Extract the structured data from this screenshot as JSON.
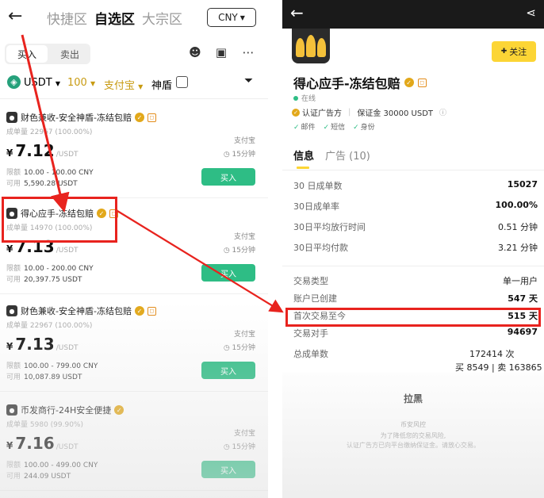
{
  "left": {
    "nav": {
      "back": "←",
      "tabs": [
        "快捷区",
        "自选区",
        "大宗区"
      ],
      "active_index": 1,
      "currency": "CNY"
    },
    "toggle": {
      "buy": "买入",
      "sell": "卖出"
    },
    "filters": {
      "coin": "USDT",
      "amount": "100",
      "payment": "支付宝",
      "shield": "神盾"
    },
    "cards": [
      {
        "merchant": "财色兼收-安全神盾-冻结包赔",
        "verified": true,
        "shield_badge": true,
        "stats_label": "成单量",
        "stats_value": "22967 (100.00%)",
        "payment": "支付宝",
        "price": "7.12",
        "unit": "USDT",
        "time": "15分钟",
        "limit_label": "限额",
        "limit": "10.00 - 100.00 CNY",
        "avail_label": "可用",
        "avail": "5,590.28 USDT",
        "button": "买入"
      },
      {
        "merchant": "得心应手-冻结包赔",
        "verified": true,
        "shield_badge": true,
        "stats_label": "成单量",
        "stats_value": "14970 (100.00%)",
        "payment": "支付宝",
        "price": "7.13",
        "unit": "USDT",
        "time": "15分钟",
        "limit_label": "限额",
        "limit": "10.00 - 200.00 CNY",
        "avail_label": "可用",
        "avail": "20,397.75 USDT",
        "button": "买入"
      },
      {
        "merchant": "财色兼收-安全神盾-冻结包赔",
        "verified": true,
        "shield_badge": true,
        "stats_label": "成单量",
        "stats_value": "22967 (100.00%)",
        "payment": "支付宝",
        "price": "7.13",
        "unit": "USDT",
        "time": "15分钟",
        "limit_label": "限额",
        "limit": "100.00 - 799.00 CNY",
        "avail_label": "可用",
        "avail": "10,087.89 USDT",
        "button": "买入"
      },
      {
        "merchant": "币发商行-24H安全便捷",
        "verified": true,
        "shield_badge": false,
        "stats_label": "成单量",
        "stats_value": "5980 (99.90%)",
        "payment": "支付宝",
        "price": "7.16",
        "unit": "USDT",
        "time": "15分钟",
        "limit_label": "限额",
        "limit": "100.00 - 499.00 CNY",
        "avail_label": "可用",
        "avail": "244.09 USDT",
        "button": "买入"
      }
    ],
    "currency_symbol": "¥"
  },
  "right": {
    "header": {
      "back": "←",
      "share": "<"
    },
    "follow": "关注",
    "name": "得心应手-冻结包赔",
    "online": "在线",
    "badges": {
      "advertiser": "认证广告方",
      "deposit": "保证金 30000 USDT"
    },
    "verify": [
      "邮件",
      "短信",
      "身份"
    ],
    "tabs": {
      "info": "信息",
      "ads": "广告 (10)"
    },
    "stats": [
      {
        "k": "30 日成单数",
        "v": "15027"
      },
      {
        "k": "30日成单率",
        "v": "100.00%"
      },
      {
        "k": "30日平均放行时间",
        "v": "0.51 分钟"
      },
      {
        "k": "30日平均付款",
        "v": "3.21 分钟"
      }
    ],
    "stats2": [
      {
        "k": "交易类型",
        "v": "单一用户"
      },
      {
        "k": "账户已创建",
        "v": "547 天"
      },
      {
        "k": "首次交易至今",
        "v": "515 天"
      },
      {
        "k": "交易对手",
        "v": "94697"
      }
    ],
    "total": {
      "k": "总成单数",
      "v1": "172414 次",
      "v2": "买 8549 | 卖 163865"
    },
    "block": "拉黑",
    "notice": [
      "币安风控",
      "为了降低您的交易风险,",
      "认证广告方已向平台缴纳保证金。请放心交易。"
    ]
  },
  "colors": {
    "accent_yellow": "#fcd535",
    "buy_green": "#2ebd85",
    "highlight_red": "#e8231e"
  }
}
